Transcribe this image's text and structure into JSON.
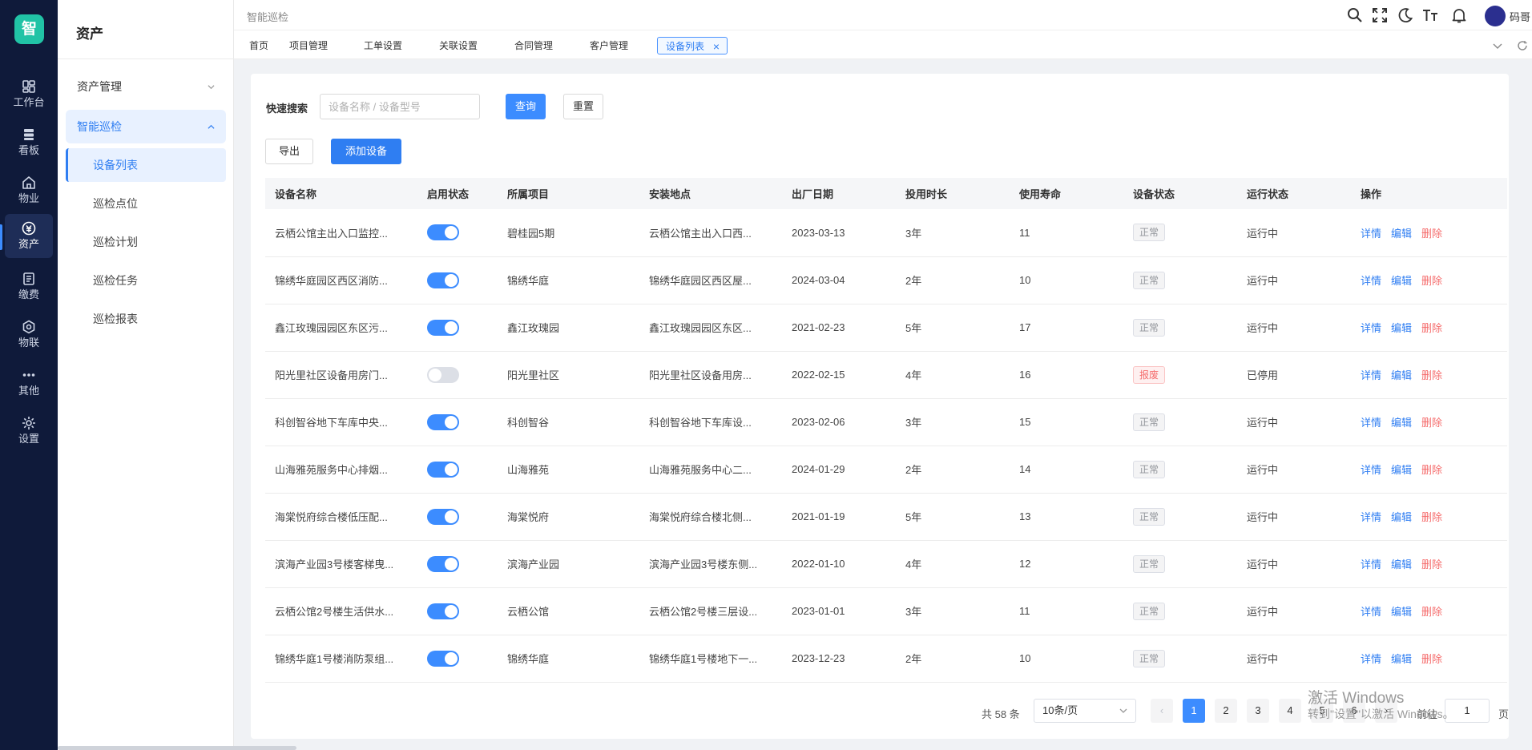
{
  "app": {
    "logo": "智",
    "module_title": "资产"
  },
  "rail": [
    {
      "label": "工作台",
      "icon": "dashboard-icon"
    },
    {
      "label": "看板",
      "icon": "kanban-icon"
    },
    {
      "label": "物业",
      "icon": "home-icon"
    },
    {
      "label": "资产",
      "icon": "asset-icon",
      "active": true
    },
    {
      "label": "缴费",
      "icon": "bill-icon"
    },
    {
      "label": "物联",
      "icon": "iot-icon"
    },
    {
      "label": "其他",
      "icon": "more-icon"
    },
    {
      "label": "设置",
      "icon": "settings-icon"
    }
  ],
  "sidebar": {
    "groups": [
      {
        "label": "资产管理",
        "open": false
      },
      {
        "label": "智能巡检",
        "open": true
      }
    ],
    "items": [
      "设备列表",
      "巡检点位",
      "巡检计划",
      "巡检任务",
      "巡检报表"
    ],
    "active_item": "设备列表"
  },
  "header": {
    "breadcrumb": "智能巡检",
    "user_name": "码哥"
  },
  "tabs": [
    "首页",
    "项目管理",
    "工单设置",
    "关联设置",
    "合同管理",
    "客户管理",
    "设备列表"
  ],
  "active_tab": "设备列表",
  "search": {
    "label": "快速搜索",
    "placeholder": "设备名称 / 设备型号",
    "query_button": "查询",
    "reset_button": "重置"
  },
  "actions": {
    "export": "导出",
    "add": "添加设备"
  },
  "table": {
    "columns": [
      "设备名称",
      "启用状态",
      "所属项目",
      "安装地点",
      "出厂日期",
      "投用时长",
      "使用寿命",
      "设备状态",
      "运行状态",
      "操作"
    ],
    "op_labels": [
      "详情",
      "编辑",
      "删除"
    ],
    "rows": [
      {
        "name": "云栖公馆主出入口监控...",
        "enabled": true,
        "project": "碧桂园5期",
        "location": "云栖公馆主出入口西...",
        "date": "2023-03-13",
        "duration": "3年",
        "life": "11",
        "device_status": "正常",
        "run_status": "运行中"
      },
      {
        "name": "锦绣华庭园区西区消防...",
        "enabled": true,
        "project": "锦绣华庭",
        "location": "锦绣华庭园区西区屋...",
        "date": "2024-03-04",
        "duration": "2年",
        "life": "10",
        "device_status": "正常",
        "run_status": "运行中"
      },
      {
        "name": "鑫江玫瑰园园区东区污...",
        "enabled": true,
        "project": "鑫江玫瑰园",
        "location": "鑫江玫瑰园园区东区...",
        "date": "2021-02-23",
        "duration": "5年",
        "life": "17",
        "device_status": "正常",
        "run_status": "运行中"
      },
      {
        "name": "阳光里社区设备用房门...",
        "enabled": false,
        "project": "阳光里社区",
        "location": "阳光里社区设备用房...",
        "date": "2022-02-15",
        "duration": "4年",
        "life": "16",
        "device_status": "报废",
        "run_status": "已停用"
      },
      {
        "name": "科创智谷地下车库中央...",
        "enabled": true,
        "project": "科创智谷",
        "location": "科创智谷地下车库设...",
        "date": "2023-02-06",
        "duration": "3年",
        "life": "15",
        "device_status": "正常",
        "run_status": "运行中"
      },
      {
        "name": "山海雅苑服务中心排烟...",
        "enabled": true,
        "project": "山海雅苑",
        "location": "山海雅苑服务中心二...",
        "date": "2024-01-29",
        "duration": "2年",
        "life": "14",
        "device_status": "正常",
        "run_status": "运行中"
      },
      {
        "name": "海棠悦府综合楼低压配...",
        "enabled": true,
        "project": "海棠悦府",
        "location": "海棠悦府综合楼北侧...",
        "date": "2021-01-19",
        "duration": "5年",
        "life": "13",
        "device_status": "正常",
        "run_status": "运行中"
      },
      {
        "name": "滨海产业园3号楼客梯曳...",
        "enabled": true,
        "project": "滨海产业园",
        "location": "滨海产业园3号楼东侧...",
        "date": "2022-01-10",
        "duration": "4年",
        "life": "12",
        "device_status": "正常",
        "run_status": "运行中"
      },
      {
        "name": "云栖公馆2号楼生活供水...",
        "enabled": true,
        "project": "云栖公馆",
        "location": "云栖公馆2号楼三层设...",
        "date": "2023-01-01",
        "duration": "3年",
        "life": "11",
        "device_status": "正常",
        "run_status": "运行中"
      },
      {
        "name": "锦绣华庭1号楼消防泵组...",
        "enabled": true,
        "project": "锦绣华庭",
        "location": "锦绣华庭1号楼地下一...",
        "date": "2023-12-23",
        "duration": "2年",
        "life": "10",
        "device_status": "正常",
        "run_status": "运行中"
      }
    ]
  },
  "pagination": {
    "total_text": "共 58 条",
    "page_size": "10条/页",
    "pages": [
      "1",
      "2",
      "3",
      "4",
      "5",
      "6"
    ],
    "current": "1",
    "prev": "‹",
    "next": "›",
    "goto_label": "前往",
    "goto_value": "1",
    "page_suffix": "页"
  },
  "watermark": {
    "line1": "激活 Windows",
    "line2": "转到\"设置\"以激活 Windows。"
  },
  "colors": {
    "primary": "#3c8cff",
    "rail_bg": "#0f1a3a",
    "logo": "#21c3a6",
    "danger": "#f56c6c"
  }
}
